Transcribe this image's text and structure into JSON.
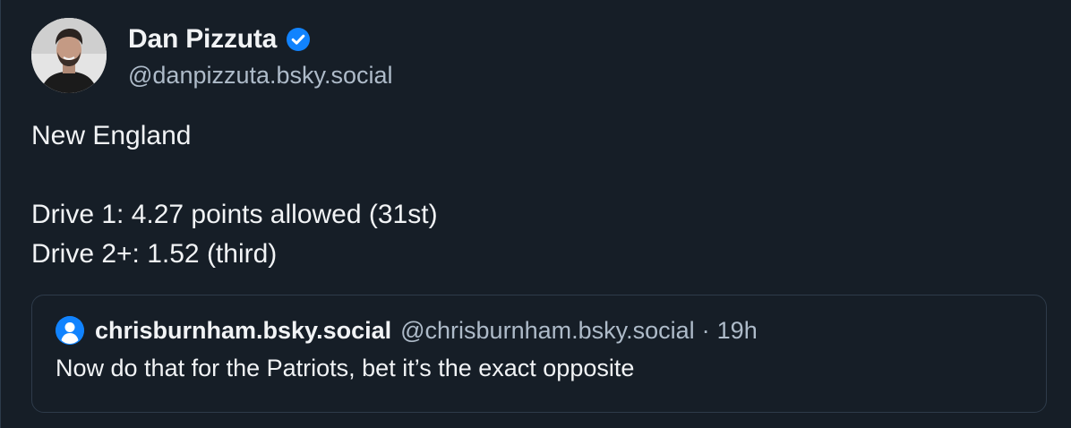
{
  "post": {
    "author": {
      "display_name": "Dan Pizzuta",
      "handle": "@danpizzuta.bsky.social",
      "verified": true
    },
    "text_lines": [
      "New England",
      "",
      "Drive 1: 4.27 points allowed (31st)",
      "Drive 2+: 1.52 (third)"
    ]
  },
  "quote": {
    "author_name": "chrisburnham.bsky.social",
    "handle": "@chrisburnham.bsky.social",
    "separator": "·",
    "time": "19h",
    "text": "Now do that for the Patriots, bet it’s the exact opposite"
  },
  "colors": {
    "background": "#161e27",
    "text": "#f1f3f5",
    "muted": "#aebbc9",
    "accent": "#1183fe",
    "border": "#2e3b4a"
  },
  "icons": {
    "verified": "verified-check-icon",
    "default_avatar": "default-user-avatar-icon"
  }
}
